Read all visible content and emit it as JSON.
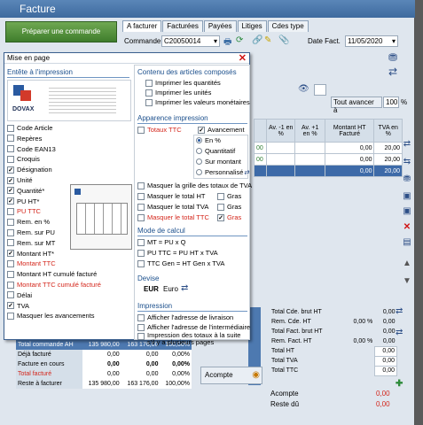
{
  "window": {
    "title": "Facture"
  },
  "toolbar": {
    "prepare_order": "Préparer une commande"
  },
  "tabs": [
    "A facturer",
    "Facturées",
    "Payées",
    "Litiges",
    "Cdes type"
  ],
  "order": {
    "label": "Commande",
    "value": "C20050014",
    "date_label": "Date Fact.",
    "date_value": "11/05/2020"
  },
  "advance": {
    "button": "Tout avancer à",
    "value": "100",
    "unit": "%"
  },
  "grid": {
    "headers": [
      "Av. -1 en %",
      "Av. +1 en %",
      "Montant HT Facturé",
      "TVA en %"
    ],
    "rows": [
      {
        "prefix": "00",
        "av_m1": "",
        "av_p1": "",
        "montant": "0,00",
        "tva": "20,00"
      },
      {
        "prefix": "00",
        "av_m1": "",
        "av_p1": "",
        "montant": "0,00",
        "tva": "20,00"
      },
      {
        "prefix": "",
        "av_m1": "",
        "av_p1": "",
        "montant": "0,00",
        "tva": "20,00"
      }
    ]
  },
  "dialog": {
    "title": "Mise en page",
    "header_section": "Entête à l'impression",
    "logo_text": "DOVAX",
    "header_checks": [
      {
        "label": "Code Article",
        "checked": false,
        "red": false
      },
      {
        "label": "Repères",
        "checked": false,
        "red": false
      },
      {
        "label": "Code EAN13",
        "checked": false,
        "red": false
      },
      {
        "label": "Croquis",
        "checked": false,
        "red": false
      },
      {
        "label": "Désignation",
        "checked": true,
        "red": false
      },
      {
        "label": "Unité",
        "checked": true,
        "red": false
      },
      {
        "label": "Quantité*",
        "checked": true,
        "red": false
      },
      {
        "label": "PU HT*",
        "checked": true,
        "red": false
      },
      {
        "label": "PU TTC",
        "checked": false,
        "red": true
      },
      {
        "label": "Rem. en %",
        "checked": false,
        "red": false
      },
      {
        "label": "Rem. sur PU",
        "checked": false,
        "red": false
      },
      {
        "label": "Rem. sur MT",
        "checked": false,
        "red": false
      },
      {
        "label": "Montant HT*",
        "checked": true,
        "red": false
      },
      {
        "label": "Montant TTC",
        "checked": false,
        "red": true
      },
      {
        "label": "Montant HT cumulé facturé",
        "checked": false,
        "red": false
      },
      {
        "label": "Montant TTC cumulé facturé",
        "checked": false,
        "red": true
      },
      {
        "label": "Délai",
        "checked": false,
        "red": false
      },
      {
        "label": "TVA",
        "checked": true,
        "red": false
      },
      {
        "label": "Masquer les avancements",
        "checked": false,
        "red": false
      }
    ],
    "contenu_section": "Contenu des articles composés",
    "contenu_checks": [
      "Imprimer les quantités",
      "Imprimer les unités",
      "Imprimer les valeurs monétaires"
    ],
    "apparence_section": "Apparence impression",
    "totaux_ttc": "Totaux TTC",
    "avancement": "Avancement",
    "radio_options": [
      "En %",
      "Quantitatif",
      "Sur montant",
      "Personnalisé"
    ],
    "masquer_grille": "Masquer la grille des totaux de TVA",
    "masquer_totals": [
      {
        "label": "Masquer le total HT",
        "gras": "Gras"
      },
      {
        "label": "Masquer le total TVA",
        "gras": "Gras"
      },
      {
        "label": "Masquer le total TTC",
        "gras": "Gras"
      }
    ],
    "calc_section": "Mode de calcul",
    "calc_options": [
      "MT = PU x Q",
      "PU TTC = PU HT x TVA",
      "TTC Gen = HT Gen x TVA"
    ],
    "devise_section": "Devise",
    "devise_code": "EUR",
    "devise_name": "Euro",
    "impression_section": "Impression",
    "impression_checks": [
      "Afficher l'adresse de livraison",
      "Afficher l'adresse de l'intermédiaire",
      "Impression des totaux à la suite s'il y a plusieurs pages"
    ]
  },
  "totals_right": [
    {
      "label": "Total Cde. brut HT",
      "value": "0,00"
    },
    {
      "label": "Rem. Cde. HT",
      "pct": "0,00 %",
      "value": "0,00"
    },
    {
      "label": "Total Fact. brut HT",
      "value": "0,00"
    },
    {
      "label": "Rem. Fact. HT",
      "pct": "0,00 %",
      "value": "0,00"
    },
    {
      "label": "Total HT",
      "value": "0,00"
    },
    {
      "label": "Total TVA",
      "value": "0,00"
    },
    {
      "label": "Total TTC",
      "value": "0,00"
    }
  ],
  "left_totals": [
    {
      "label": "Total commande AH",
      "v1": "135 980,00",
      "v2": "163 176,00",
      "v3": "100,00%"
    },
    {
      "label": "Déjà facturé",
      "v1": "0,00",
      "v2": "0,00",
      "v3": "0,00%"
    },
    {
      "label": "Facture en cours",
      "v1": "0,00",
      "v2": "0,00",
      "v3": "0,00%"
    },
    {
      "label": "Total facturé",
      "v1": "0,00",
      "v2": "0,00",
      "v3": "0,00%"
    },
    {
      "label": "Reste à facturer",
      "v1": "135 980,00",
      "v2": "163 176,00",
      "v3": "100,00%"
    }
  ],
  "acompte": {
    "button": "Acompte",
    "label": "Acompte",
    "value": "0,00",
    "reste_label": "Reste dû",
    "reste_value": "0,00"
  }
}
